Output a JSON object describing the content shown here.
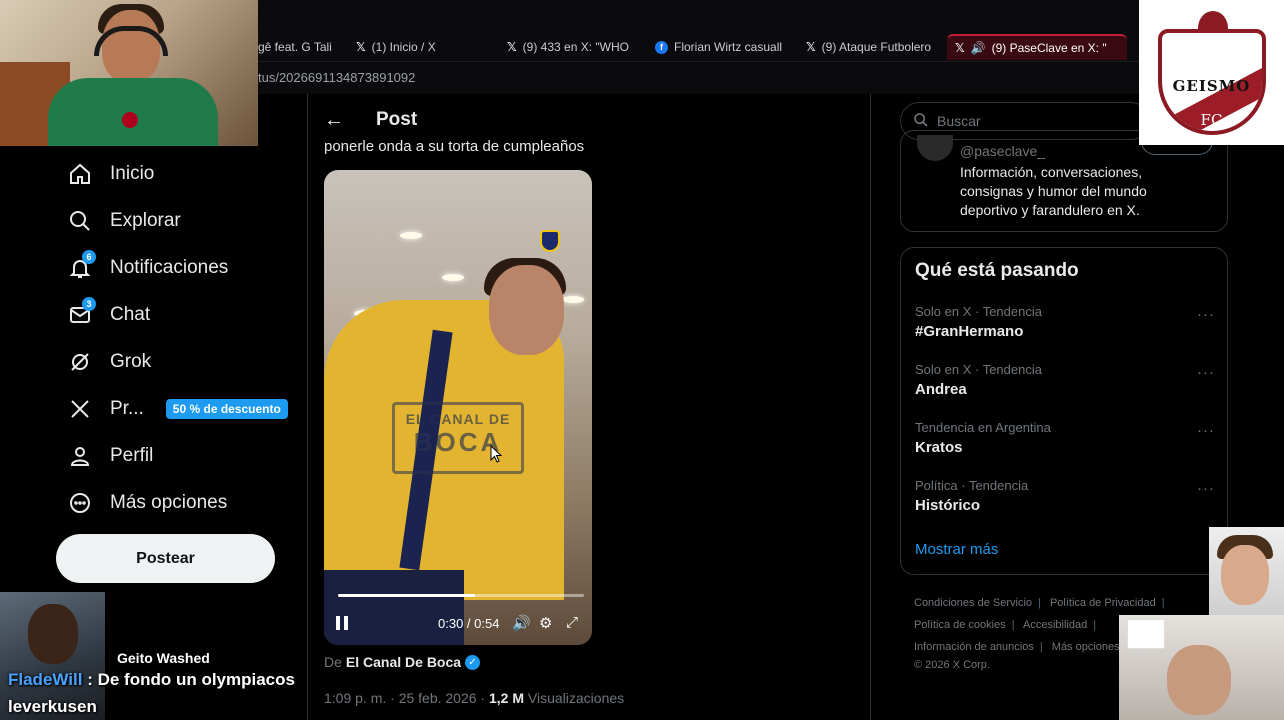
{
  "browser": {
    "tabs": [
      {
        "label": "gê feat. G Tali",
        "icon": "none"
      },
      {
        "label": "(1) Inicio / X",
        "icon": "x-icon"
      },
      {
        "label": "(9) 433 en X: \"WHO",
        "icon": "x-icon"
      },
      {
        "label": "Florian Wirtz casuall",
        "icon": "facebook-icon"
      },
      {
        "label": "(9) Ataque Futbolero",
        "icon": "x-icon"
      },
      {
        "label": "(9) PaseClave en X: \"",
        "icon": "x-icon",
        "active": true
      }
    ],
    "url": "tus/2026691134873891092"
  },
  "stream": {
    "chat_name": "Geito Washed",
    "chat_user": "FladeWill",
    "chat_message": "De fondo un olympiacos leverkusen",
    "logo_text": "GEISMO",
    "logo_fc": "FC"
  },
  "nav": {
    "items": [
      {
        "label": "Inicio",
        "icon": "home-icon"
      },
      {
        "label": "Explorar",
        "icon": "search-icon"
      },
      {
        "label": "Notificaciones",
        "icon": "bell-icon",
        "badge": "6"
      },
      {
        "label": "Chat",
        "icon": "mail-icon",
        "badge": "3"
      },
      {
        "label": "Grok",
        "icon": "grok-icon"
      },
      {
        "label": "Pr...",
        "icon": "x-logo-icon",
        "pill": "50 % de descuento"
      },
      {
        "label": "Perfil",
        "icon": "person-icon"
      },
      {
        "label": "Más opciones",
        "icon": "more-circle-icon"
      }
    ],
    "post_button": "Postear"
  },
  "post": {
    "header_title": "Post",
    "text": "ponerle onda a su torta de cumpleaños",
    "video": {
      "watermark_line1": "EL CANAL DE",
      "watermark_line2": "BOCA",
      "time": "0:30 / 0:54",
      "progress": 0.556
    },
    "source_prefix": "De",
    "source_name": "El Canal De Boca",
    "meta_time": "1:09 p. m. · 25 feb. 2026 ·",
    "meta_views": "1,2 M",
    "meta_views_label": "Visualizaciones"
  },
  "sidebar": {
    "search_placeholder": "Buscar",
    "profile_handle": "@paseclave_",
    "profile_bio": "Información, conversaciones, consignas y humor del mundo deportivo y farandulero en X.",
    "trends_title": "Qué está pasando",
    "trends": [
      {
        "context": "Solo en X · Tendencia",
        "name": "#GranHermano"
      },
      {
        "context": "Solo en X · Tendencia",
        "name": "Andrea"
      },
      {
        "context": "Tendencia en Argentina",
        "name": "Kratos"
      },
      {
        "context": "Política · Tendencia",
        "name": "Histórico"
      }
    ],
    "show_more": "Mostrar más",
    "footer": {
      "terms": "Condiciones de Servicio",
      "privacy": "Política de Privacidad",
      "cookies": "Política de cookies",
      "accessibility": "Accesibilidad",
      "ads_info": "Información de anuncios",
      "more": "Más opciones ···",
      "copyright": "© 2026 X Corp."
    }
  },
  "colors": {
    "accent": "#1d9bf0",
    "background": "#000000",
    "active_tab": "#c41f36"
  }
}
